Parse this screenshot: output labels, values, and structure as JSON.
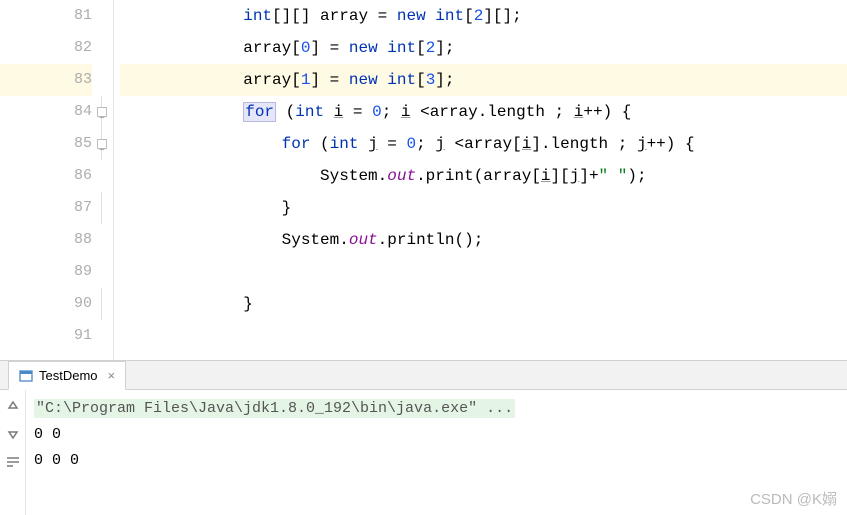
{
  "editor": {
    "lines": [
      {
        "num": 81,
        "indent": "            ",
        "tokens": [
          {
            "t": "kw",
            "v": "int"
          },
          {
            "t": "op",
            "v": "[][] "
          },
          {
            "t": "ident",
            "v": "array"
          },
          {
            "t": "op",
            "v": " = "
          },
          {
            "t": "kw",
            "v": "new int"
          },
          {
            "t": "op",
            "v": "["
          },
          {
            "t": "num",
            "v": "2"
          },
          {
            "t": "op",
            "v": "][];"
          }
        ]
      },
      {
        "num": 82,
        "indent": "            ",
        "tokens": [
          {
            "t": "ident",
            "v": "array"
          },
          {
            "t": "op",
            "v": "["
          },
          {
            "t": "num",
            "v": "0"
          },
          {
            "t": "op",
            "v": "] = "
          },
          {
            "t": "kw",
            "v": "new int"
          },
          {
            "t": "op",
            "v": "["
          },
          {
            "t": "num",
            "v": "2"
          },
          {
            "t": "op",
            "v": "];"
          }
        ]
      },
      {
        "num": 83,
        "indent": "            ",
        "current": true,
        "tokens": [
          {
            "t": "ident",
            "v": "array"
          },
          {
            "t": "op",
            "v": "["
          },
          {
            "t": "num",
            "v": "1"
          },
          {
            "t": "op",
            "v": "] = "
          },
          {
            "t": "kw",
            "v": "new int"
          },
          {
            "t": "op",
            "v": "["
          },
          {
            "t": "num",
            "v": "3"
          },
          {
            "t": "op",
            "v": "];"
          }
        ]
      },
      {
        "num": 84,
        "indent": "            ",
        "fold": true,
        "tokens": [
          {
            "t": "hl",
            "v": "for"
          },
          {
            "t": "op",
            "v": " ("
          },
          {
            "t": "kw",
            "v": "int"
          },
          {
            "t": "op",
            "v": " "
          },
          {
            "t": "u",
            "v": "i"
          },
          {
            "t": "op",
            "v": " = "
          },
          {
            "t": "num",
            "v": "0"
          },
          {
            "t": "op",
            "v": "; "
          },
          {
            "t": "u",
            "v": "i"
          },
          {
            "t": "op",
            "v": " <"
          },
          {
            "t": "ident",
            "v": "array"
          },
          {
            "t": "op",
            "v": "."
          },
          {
            "t": "ident",
            "v": "length"
          },
          {
            "t": "op",
            "v": " ; "
          },
          {
            "t": "u",
            "v": "i"
          },
          {
            "t": "op",
            "v": "++) {"
          }
        ]
      },
      {
        "num": 85,
        "indent": "                ",
        "fold": true,
        "tokens": [
          {
            "t": "kw",
            "v": "for"
          },
          {
            "t": "op",
            "v": " ("
          },
          {
            "t": "kw",
            "v": "int"
          },
          {
            "t": "op",
            "v": " "
          },
          {
            "t": "u",
            "v": "j"
          },
          {
            "t": "op",
            "v": " = "
          },
          {
            "t": "num",
            "v": "0"
          },
          {
            "t": "op",
            "v": "; "
          },
          {
            "t": "u",
            "v": "j"
          },
          {
            "t": "op",
            "v": " <"
          },
          {
            "t": "ident",
            "v": "array"
          },
          {
            "t": "op",
            "v": "["
          },
          {
            "t": "u",
            "v": "i"
          },
          {
            "t": "op",
            "v": "]."
          },
          {
            "t": "ident",
            "v": "length"
          },
          {
            "t": "op",
            "v": " ; "
          },
          {
            "t": "u",
            "v": "j"
          },
          {
            "t": "op",
            "v": "++) {"
          }
        ]
      },
      {
        "num": 86,
        "indent": "                    ",
        "tokens": [
          {
            "t": "ident",
            "v": "System"
          },
          {
            "t": "op",
            "v": "."
          },
          {
            "t": "field",
            "v": "out"
          },
          {
            "t": "op",
            "v": "."
          },
          {
            "t": "ident",
            "v": "print"
          },
          {
            "t": "op",
            "v": "("
          },
          {
            "t": "ident",
            "v": "array"
          },
          {
            "t": "op",
            "v": "["
          },
          {
            "t": "u",
            "v": "i"
          },
          {
            "t": "op",
            "v": "]["
          },
          {
            "t": "u",
            "v": "j"
          },
          {
            "t": "op",
            "v": "]+"
          },
          {
            "t": "str",
            "v": "\" \""
          },
          {
            "t": "op",
            "v": ");"
          }
        ]
      },
      {
        "num": 87,
        "indent": "                ",
        "foldend": true,
        "tokens": [
          {
            "t": "op",
            "v": "}"
          }
        ]
      },
      {
        "num": 88,
        "indent": "                ",
        "tokens": [
          {
            "t": "ident",
            "v": "System"
          },
          {
            "t": "op",
            "v": "."
          },
          {
            "t": "field",
            "v": "out"
          },
          {
            "t": "op",
            "v": "."
          },
          {
            "t": "ident",
            "v": "println"
          },
          {
            "t": "op",
            "v": "();"
          }
        ]
      },
      {
        "num": 89,
        "indent": "",
        "tokens": []
      },
      {
        "num": 90,
        "indent": "            ",
        "foldend": true,
        "tokens": [
          {
            "t": "op",
            "v": "}"
          }
        ]
      },
      {
        "num": 91,
        "indent": "",
        "tokens": []
      }
    ]
  },
  "console": {
    "tab_label": "TestDemo",
    "cmd": "\"C:\\Program Files\\Java\\jdk1.8.0_192\\bin\\java.exe\" ...",
    "output": [
      "0 0",
      "0 0 0"
    ]
  },
  "watermark": "CSDN @K嫋"
}
